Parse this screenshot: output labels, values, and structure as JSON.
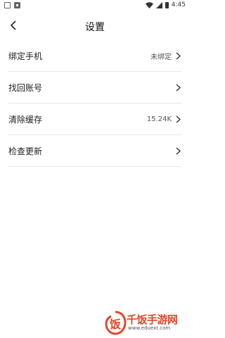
{
  "status_bar": {
    "time": "4:45"
  },
  "header": {
    "title": "设置"
  },
  "settings": [
    {
      "label": "绑定手机",
      "value": "未绑定"
    },
    {
      "label": "找回账号",
      "value": ""
    },
    {
      "label": "清除缓存",
      "value": "15.24K"
    },
    {
      "label": "检查更新",
      "value": ""
    }
  ],
  "watermark": {
    "logo_text": "饭",
    "name": "千饭手游网",
    "url": "www.eduext.com"
  },
  "icons": [
    "image-icon",
    "download-icon",
    "wifi-icon",
    "signal-icon",
    "battery-icon",
    "back-arrow-icon",
    "chevron-right-icon"
  ]
}
